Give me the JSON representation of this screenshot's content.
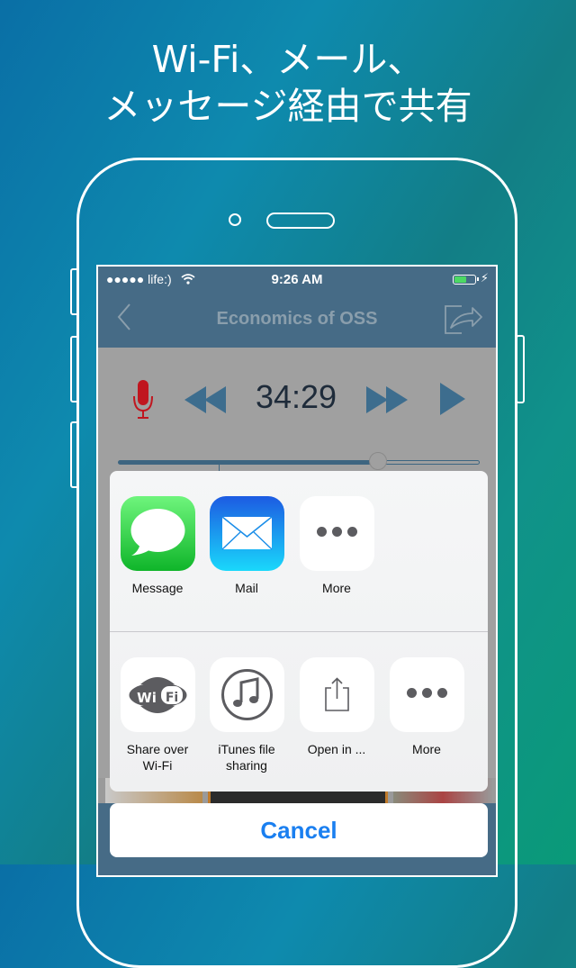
{
  "headline": {
    "line1": "Wi-Fi、メール、",
    "line2": "メッセージ経由で共有"
  },
  "status_bar": {
    "carrier": "●●●●● life:)",
    "time": "9:26 AM",
    "battery_percent": 60,
    "charging_icon": "⚡"
  },
  "nav_bar": {
    "back_icon": "‹",
    "title": "Economics of OSS"
  },
  "player": {
    "elapsed": "34:29",
    "progress_fraction": 0.72
  },
  "share_sheet": {
    "row1": [
      {
        "label": "Message",
        "icon": "message-bubble"
      },
      {
        "label": "Mail",
        "icon": "envelope"
      },
      {
        "label": "More",
        "icon": "ellipsis"
      }
    ],
    "row2": [
      {
        "label_line1": "Share over",
        "label_line2": "Wi-Fi",
        "icon": "wifi-logo"
      },
      {
        "label_line1": "iTunes file",
        "label_line2": "sharing",
        "icon": "music-note"
      },
      {
        "label_line1": "Open in ...",
        "label_line2": "",
        "icon": "share-box"
      },
      {
        "label_line1": "More",
        "label_line2": "",
        "icon": "ellipsis"
      }
    ],
    "cancel_label": "Cancel",
    "wifi_logo_text_a": "Wi",
    "wifi_logo_text_b": "Fi"
  },
  "colors": {
    "accent": "#1a7ff0",
    "bar": "#466b86",
    "mic": "#c0161f",
    "controls": "#3d6d8e"
  }
}
